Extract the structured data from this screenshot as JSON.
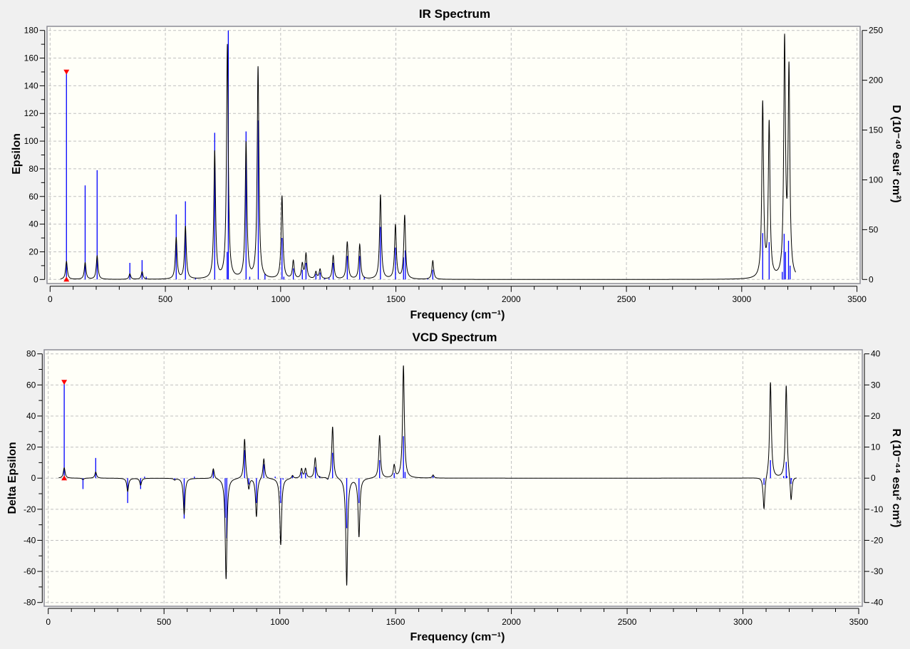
{
  "colors": {
    "background": "#f0f0f0",
    "plot_background": "#fffff8",
    "curve": "#000000",
    "sticks": "#0000ff",
    "marker": "#ff0000",
    "grid": "#c0c0c0",
    "frame": "#8c8c96"
  },
  "chart_data": [
    {
      "type": "line",
      "title": "IR Spectrum",
      "xlabel": "Frequency (cm⁻¹)",
      "ylabel": "Epsilon",
      "y2label": "D (10⁻⁴⁰ esu² cm²)",
      "xlim": [
        0,
        3500
      ],
      "ylim": [
        0,
        180
      ],
      "y2lim": [
        0,
        250
      ],
      "grid": true,
      "xticks": [
        0,
        500,
        1000,
        1500,
        2000,
        2500,
        3000,
        3500
      ],
      "yticks": [
        0,
        20,
        40,
        60,
        80,
        100,
        120,
        140,
        160,
        180
      ],
      "y2ticks": [
        0,
        50,
        100,
        150,
        200,
        250
      ],
      "curve_range": [
        45,
        3234
      ],
      "selected_frequency": 71,
      "spectrum_peaks": [
        [
          71,
          13
        ],
        [
          152,
          12
        ],
        [
          204,
          17
        ],
        [
          346,
          4
        ],
        [
          399,
          5.5
        ],
        [
          547,
          30
        ],
        [
          587,
          38
        ],
        [
          714,
          92
        ],
        [
          769,
          169
        ],
        [
          850,
          98
        ],
        [
          902,
          153
        ],
        [
          1006,
          60
        ],
        [
          1055,
          13
        ],
        [
          1094,
          10.5
        ],
        [
          1110,
          18
        ],
        [
          1153,
          5
        ],
        [
          1171,
          7
        ],
        [
          1228,
          17
        ],
        [
          1289,
          27
        ],
        [
          1343,
          25
        ],
        [
          1433,
          61
        ],
        [
          1498,
          39
        ],
        [
          1538,
          46
        ],
        [
          1660,
          13.5
        ],
        [
          3091,
          126
        ],
        [
          3119,
          111
        ],
        [
          3186,
          169
        ],
        [
          3205,
          148
        ]
      ],
      "sticks": [
        [
          71,
          149.6
        ],
        [
          152,
          68
        ],
        [
          204,
          79
        ],
        [
          346,
          12
        ],
        [
          399,
          14
        ],
        [
          417,
          2
        ],
        [
          547,
          47
        ],
        [
          587,
          56.5
        ],
        [
          631,
          1
        ],
        [
          714,
          106
        ],
        [
          768,
          20
        ],
        [
          773,
          180
        ],
        [
          850,
          107
        ],
        [
          866,
          2
        ],
        [
          903,
          115
        ],
        [
          932,
          4
        ],
        [
          1006,
          30
        ],
        [
          1014,
          2
        ],
        [
          1055,
          8
        ],
        [
          1094,
          7
        ],
        [
          1110,
          12
        ],
        [
          1153,
          4
        ],
        [
          1171,
          5
        ],
        [
          1191,
          1
        ],
        [
          1210,
          1
        ],
        [
          1228,
          12
        ],
        [
          1289,
          17
        ],
        [
          1343,
          17
        ],
        [
          1363,
          2
        ],
        [
          1433,
          38
        ],
        [
          1498,
          23
        ],
        [
          1533,
          16
        ],
        [
          1541,
          21
        ],
        [
          1638,
          1
        ],
        [
          1660,
          7
        ],
        [
          3091,
          33.5
        ],
        [
          3119,
          27
        ],
        [
          3176,
          5.5
        ],
        [
          3184,
          33
        ],
        [
          3190,
          20
        ],
        [
          3203,
          28
        ],
        [
          3210,
          10
        ]
      ]
    },
    {
      "type": "line",
      "title": "VCD Spectrum",
      "xlabel": "Frequency (cm⁻¹)",
      "ylabel": "Delta Epsilon",
      "y2label": "R (10⁻⁴⁴ esu² cm²)",
      "xlim": [
        0,
        3500
      ],
      "ylim": [
        -80,
        80
      ],
      "y2lim": [
        -40,
        40
      ],
      "grid": true,
      "xticks": [
        0,
        500,
        1000,
        1500,
        2000,
        2500,
        3000,
        3500
      ],
      "yticks": [
        -80,
        -60,
        -40,
        -20,
        0,
        20,
        40,
        60,
        80
      ],
      "y2ticks": [
        -40,
        -30,
        -20,
        -10,
        0,
        10,
        20,
        30,
        40
      ],
      "curve_range": [
        45,
        3232
      ],
      "selected_frequency": 69,
      "spectrum_peaks": [
        [
          69,
          6.7
        ],
        [
          150,
          -1
        ],
        [
          205,
          4
        ],
        [
          343,
          -8.5
        ],
        [
          399,
          -4.5
        ],
        [
          546,
          -1
        ],
        [
          587,
          -23
        ],
        [
          713,
          6.5
        ],
        [
          768,
          -65
        ],
        [
          848,
          26
        ],
        [
          866,
          -8
        ],
        [
          899,
          -25
        ],
        [
          931,
          13
        ],
        [
          1004,
          -43
        ],
        [
          1055,
          2
        ],
        [
          1094,
          6
        ],
        [
          1111,
          6
        ],
        [
          1153,
          13
        ],
        [
          1207,
          -2
        ],
        [
          1228,
          33.5
        ],
        [
          1289,
          -69
        ],
        [
          1342,
          -37.6
        ],
        [
          1431,
          27.6
        ],
        [
          1494,
          8
        ],
        [
          1534,
          72.4
        ],
        [
          1662,
          2
        ],
        [
          3091,
          -21.2
        ],
        [
          3119,
          62
        ],
        [
          3187,
          60
        ],
        [
          3208,
          -16.5
        ]
      ],
      "sticks": [
        [
          69,
          61.4
        ],
        [
          150,
          -7
        ],
        [
          205,
          13
        ],
        [
          343,
          -16
        ],
        [
          399,
          -7
        ],
        [
          416,
          1
        ],
        [
          546,
          -1
        ],
        [
          587,
          -26
        ],
        [
          631,
          1
        ],
        [
          713,
          5
        ],
        [
          764,
          -25.5
        ],
        [
          771,
          -38.7
        ],
        [
          848,
          18
        ],
        [
          866,
          -4
        ],
        [
          899,
          -16
        ],
        [
          931,
          9
        ],
        [
          980,
          1
        ],
        [
          1004,
          -16
        ],
        [
          1014,
          -1
        ],
        [
          1055,
          1.7
        ],
        [
          1094,
          3.7
        ],
        [
          1111,
          3.4
        ],
        [
          1154,
          7.2
        ],
        [
          1172,
          1.4
        ],
        [
          1209,
          -0.6
        ],
        [
          1228,
          16.3
        ],
        [
          1289,
          -32.2
        ],
        [
          1342,
          -16
        ],
        [
          1431,
          11.6
        ],
        [
          1494,
          3.4
        ],
        [
          1534,
          27
        ],
        [
          1541,
          4
        ],
        [
          1662,
          1.4
        ],
        [
          3091,
          -4.3
        ],
        [
          3119,
          11.6
        ],
        [
          3176,
          1.4
        ],
        [
          3187,
          10.5
        ],
        [
          3190,
          1.4
        ],
        [
          3208,
          -3.7
        ],
        [
          3210,
          -1
        ]
      ]
    }
  ]
}
